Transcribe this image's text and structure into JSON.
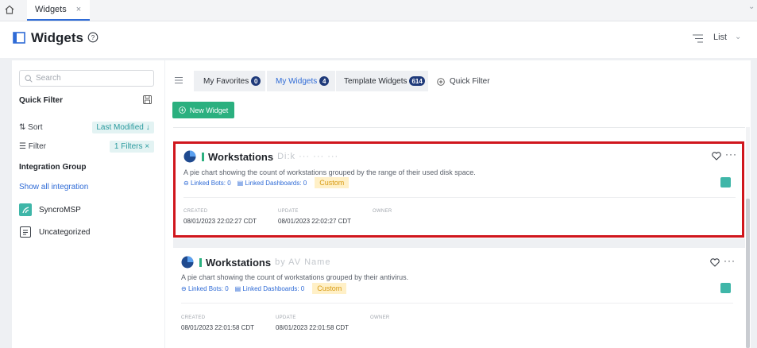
{
  "tabbar": {
    "tab_label": "Widgets",
    "close": "×"
  },
  "header": {
    "title": "Widgets",
    "view_label": "List"
  },
  "sidebar": {
    "search_placeholder": "Search",
    "quick_filter_title": "Quick Filter",
    "sort_label": "Sort",
    "sort_value": "Last Modified ↓",
    "filter_label": "Filter",
    "filter_value": "1 Filters ×",
    "integration_group_title": "Integration Group",
    "show_all": "Show all integration",
    "integrations": [
      {
        "label": "SyncroMSP"
      },
      {
        "label": "Uncategorized"
      }
    ]
  },
  "content": {
    "tabs": [
      {
        "label": "My Favorites",
        "count": "0"
      },
      {
        "label": "My Widgets",
        "count": "4"
      },
      {
        "label": "Template Widgets",
        "count": "614"
      }
    ],
    "quick_filter": "Quick Filter",
    "new_widget": "New Widget"
  },
  "cards": [
    {
      "title": "Workstations",
      "title_suffix": "Di:k ··· ··· ···",
      "description": "A pie chart showing the count of workstations grouped by the range of their used disk space.",
      "linked_bots": "Linked Bots: 0",
      "linked_dashboards": "Linked Dashboards: 0",
      "tag": "Custom",
      "created_label": "CREATED",
      "created": "08/01/2023 22:02:27 CDT",
      "update_label": "UPDATE",
      "update": "08/01/2023 22:02:27 CDT",
      "owner_label": "OWNER",
      "more": "···"
    },
    {
      "title": "Workstations",
      "title_suffix": "by AV Name",
      "description": "A pie chart showing the count of workstations grouped by their antivirus.",
      "linked_bots": "Linked Bots: 0",
      "linked_dashboards": "Linked Dashboards: 0",
      "tag": "Custom",
      "created_label": "CREATED",
      "created": "08/01/2023 22:01:58 CDT",
      "update_label": "UPDATE",
      "update": "08/01/2023 22:01:58 CDT",
      "owner_label": "OWNER",
      "more": "···"
    }
  ],
  "colors": {
    "accent": "#2f6bd6",
    "green": "#2bb07f",
    "highlight": "#d0161d",
    "custom_tag": "#fff0c7"
  }
}
